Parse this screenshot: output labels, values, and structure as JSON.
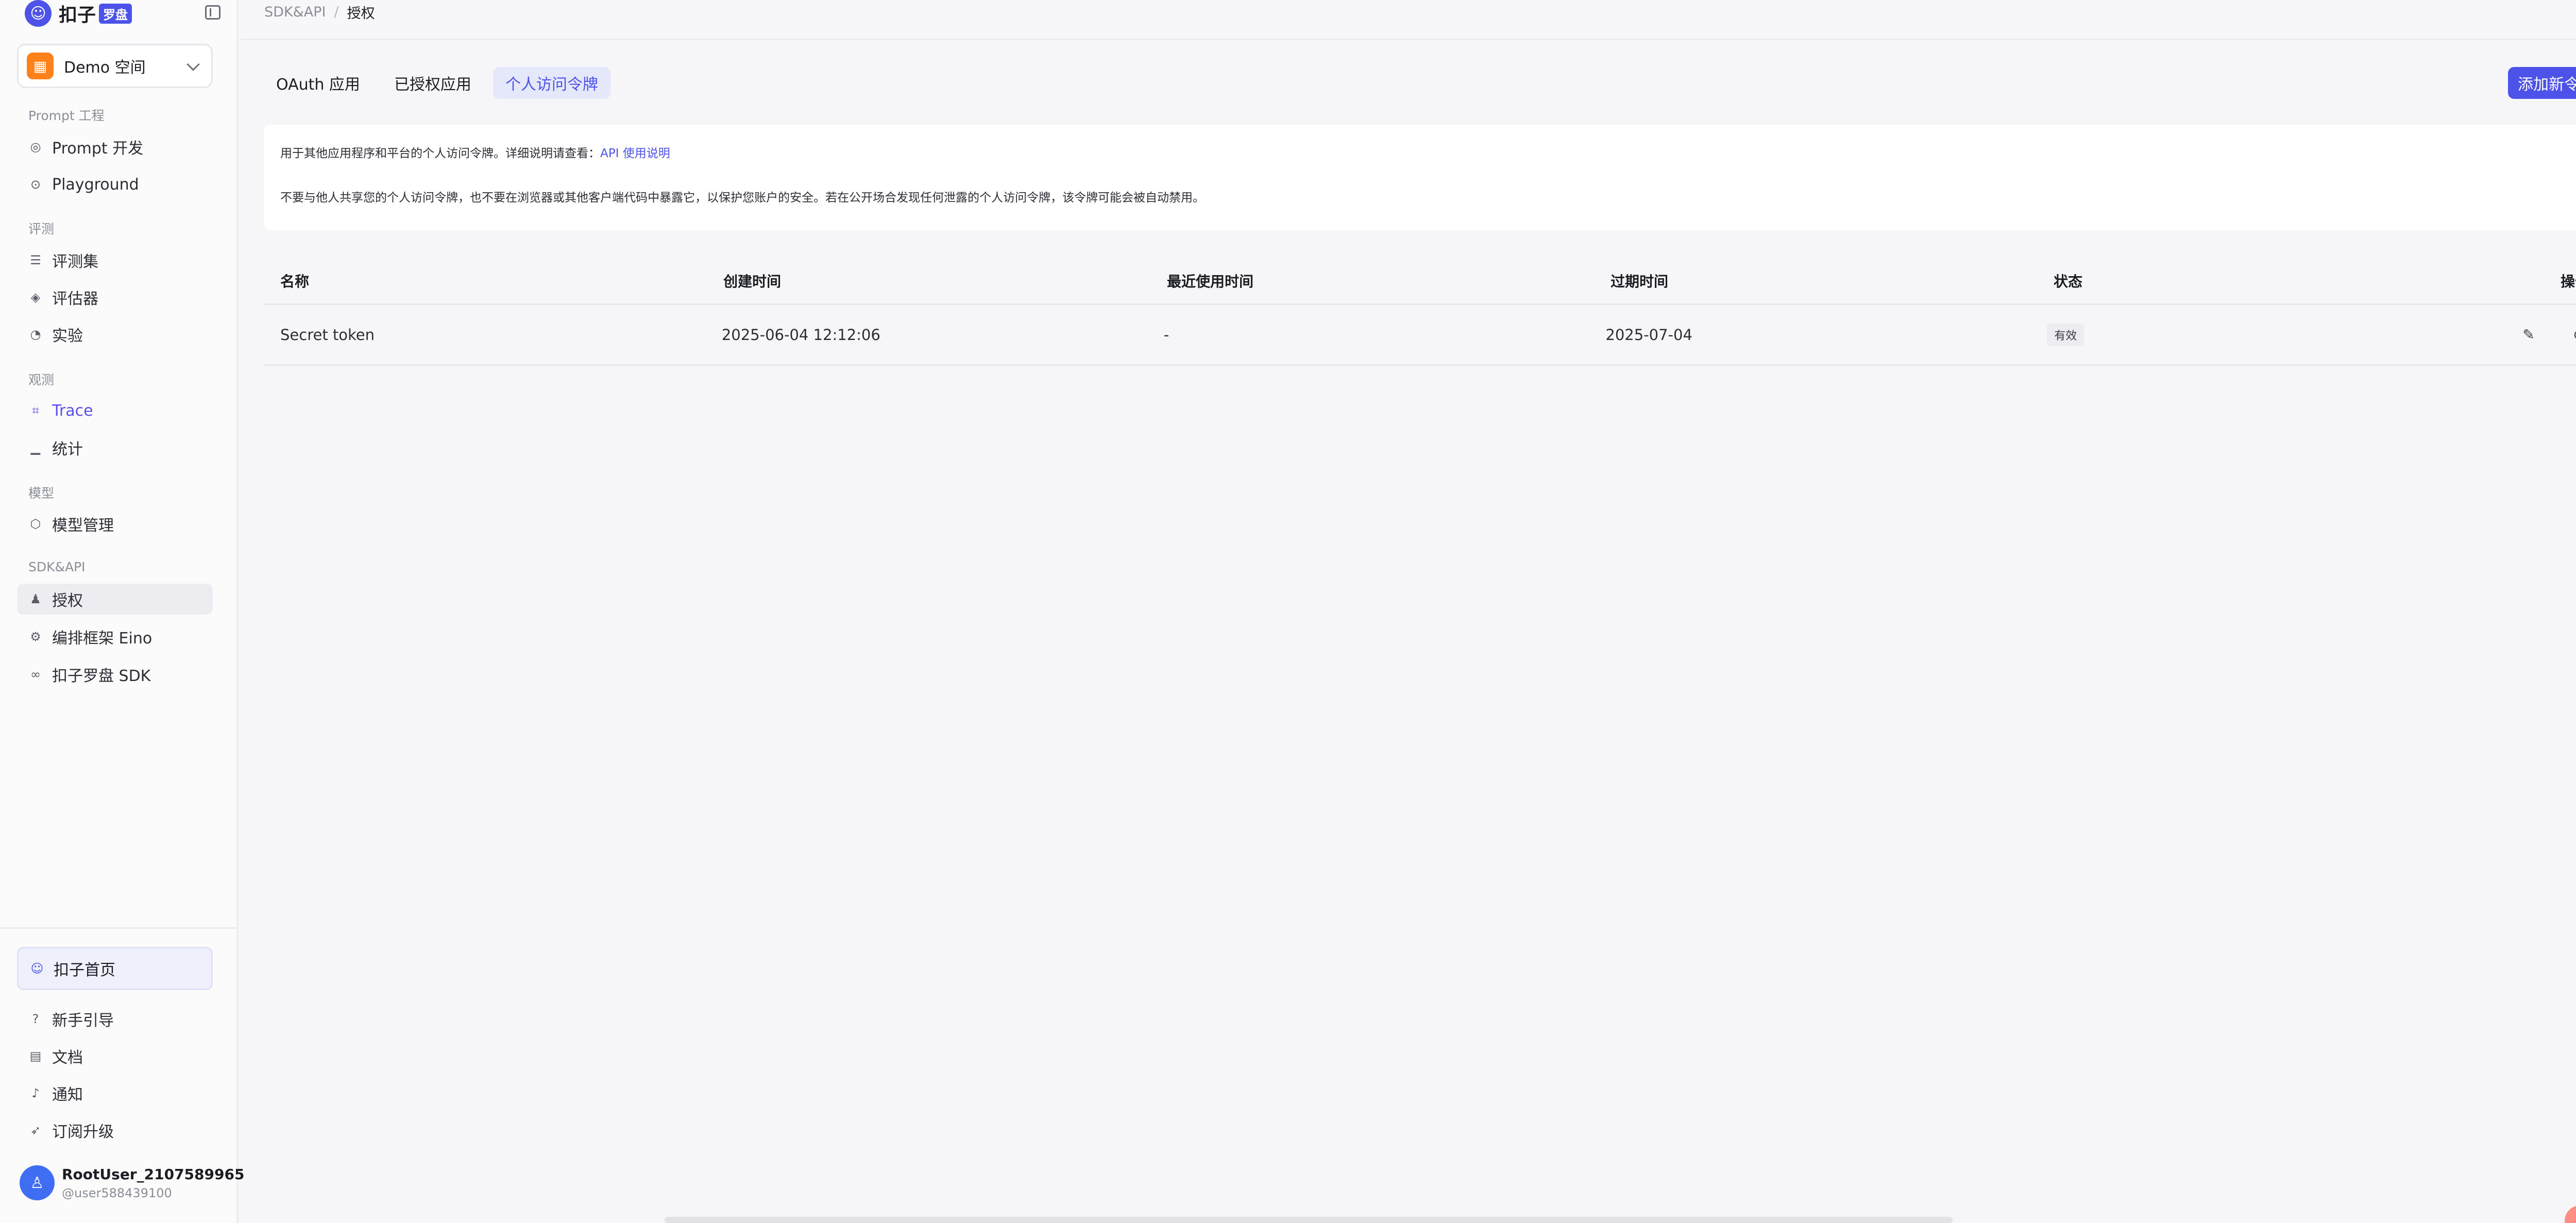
{
  "app": {
    "name": "扣子",
    "badge": "罗盘"
  },
  "workspace": {
    "name": "Demo 空间"
  },
  "sidebar": {
    "groups": [
      {
        "label": "Prompt 工程",
        "items": [
          {
            "label": "Prompt 开发"
          },
          {
            "label": "Playground"
          }
        ]
      },
      {
        "label": "评测",
        "items": [
          {
            "label": "评测集"
          },
          {
            "label": "评估器"
          },
          {
            "label": "实验"
          }
        ]
      },
      {
        "label": "观测",
        "items": [
          {
            "label": "Trace"
          },
          {
            "label": "统计"
          }
        ]
      },
      {
        "label": "模型",
        "items": [
          {
            "label": "模型管理"
          }
        ]
      },
      {
        "label": "SDK&API",
        "items": [
          {
            "label": "授权"
          },
          {
            "label": "编排框架 Eino"
          },
          {
            "label": "扣子罗盘 SDK"
          }
        ]
      }
    ],
    "home": "扣子首页",
    "footer_items": [
      {
        "label": "新手引导"
      },
      {
        "label": "文档"
      },
      {
        "label": "通知"
      },
      {
        "label": "订阅升级"
      }
    ],
    "user": {
      "name": "RootUser_2107589965",
      "handle": "@user588439100"
    }
  },
  "breadcrumb": {
    "parent": "SDK&API",
    "separator": "/",
    "current": "授权"
  },
  "tabs": [
    {
      "label": "OAuth 应用"
    },
    {
      "label": "已授权应用"
    },
    {
      "label": "个人访问令牌"
    }
  ],
  "primary_button": "添加新令牌",
  "info": {
    "line1": "用于其他应用程序和平台的个人访问令牌。详细说明请查看：",
    "link": "API 使用说明",
    "line2": "不要与他人共享您的个人访问令牌，也不要在浏览器或其他客户端代码中暴露它，以保护您账户的安全。若在公开场合发现任何泄露的个人访问令牌，该令牌可能会被自动禁用。"
  },
  "table": {
    "headers": [
      "名称",
      "创建时间",
      "最近使用时间",
      "过期时间",
      "状态",
      "操作"
    ],
    "rows": [
      {
        "name": "Secret token",
        "created": "2025-06-04 12:12:06",
        "last_used": "-",
        "expires": "2025-07-04",
        "status": "有效"
      }
    ]
  },
  "icons": {
    "edit": "edit-icon",
    "disable": "disable-icon"
  },
  "colors": {
    "accent": "#4d53e8",
    "workspace": "#ff811a",
    "avatar": "#3f6ef5"
  }
}
